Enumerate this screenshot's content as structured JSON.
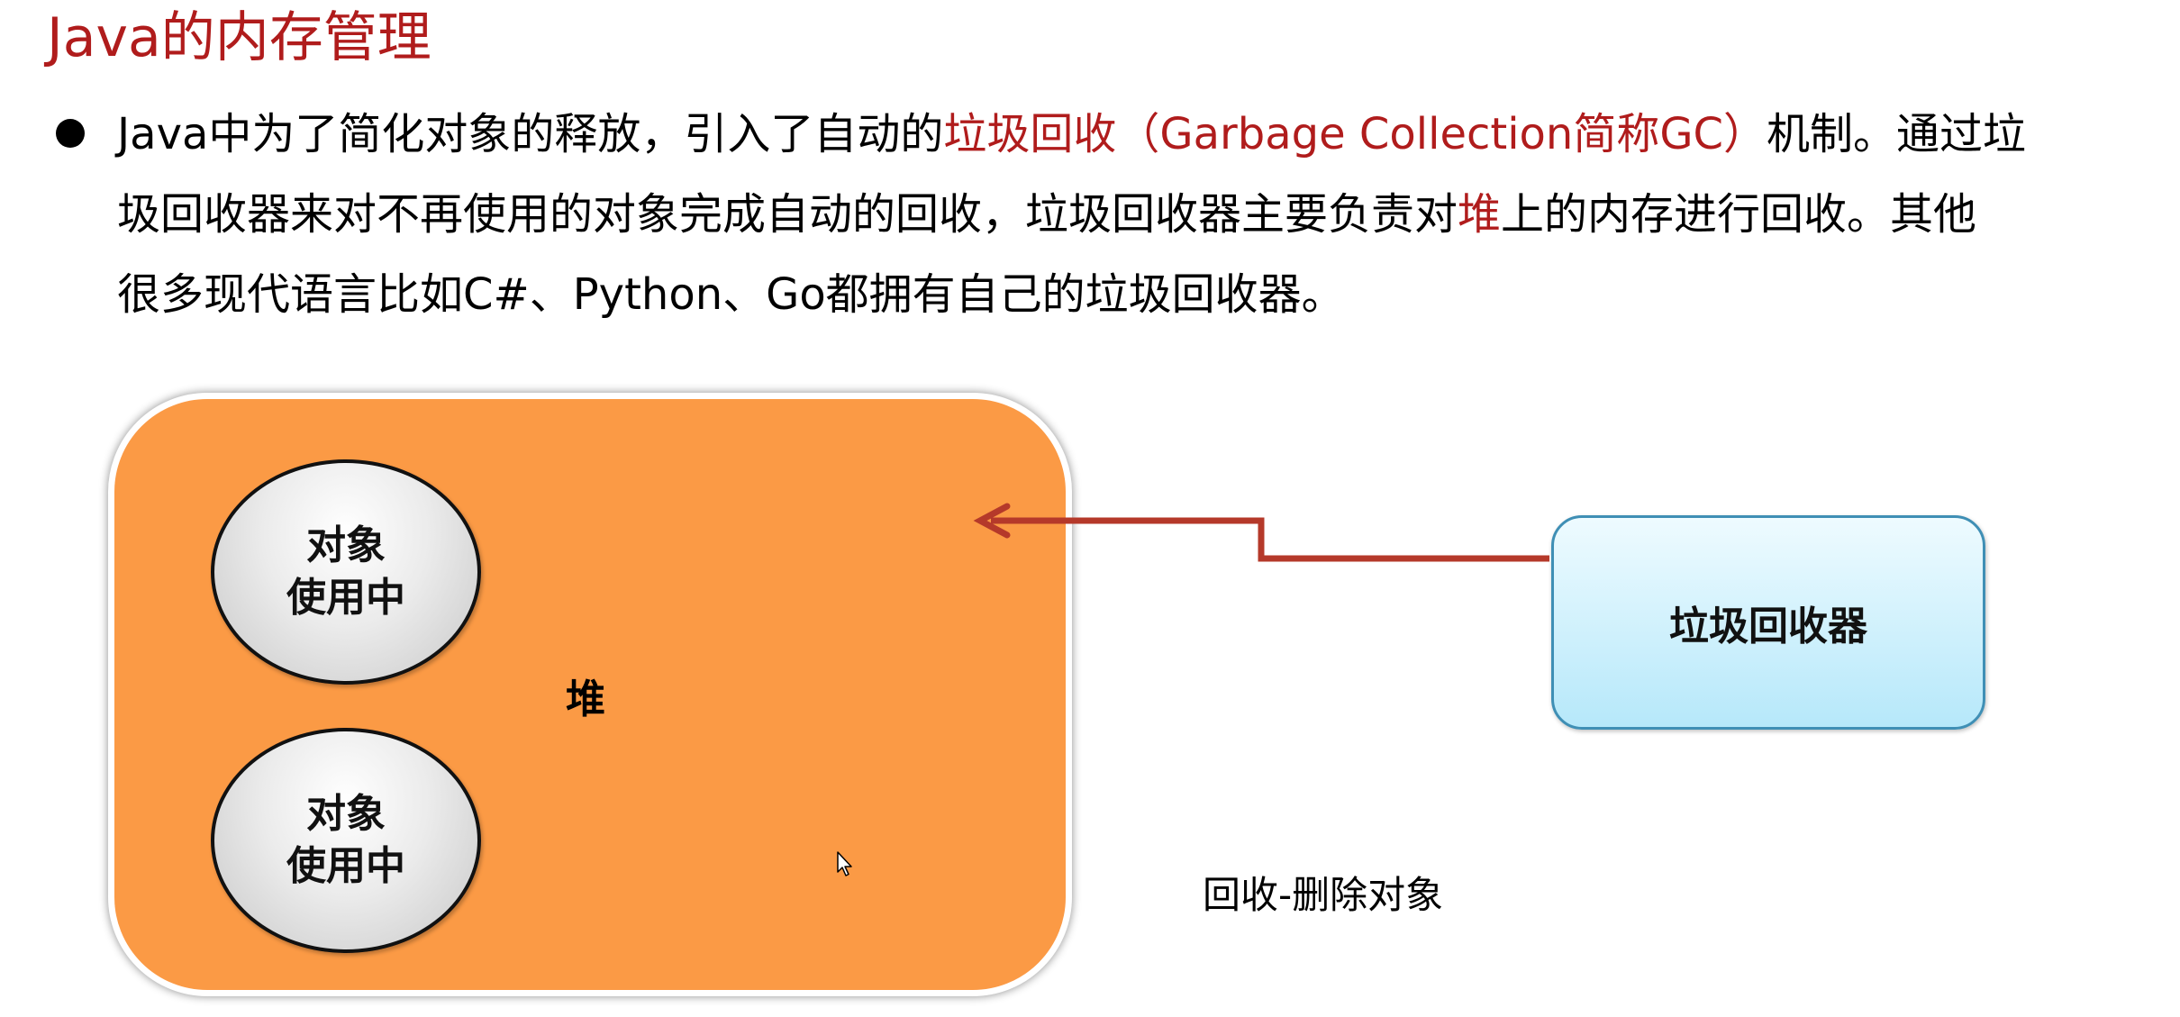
{
  "slide": {
    "title": "Java的内存管理"
  },
  "bullet": {
    "line1_a": "Java中为了简化对象的释放，引入了自动的",
    "line1_hl": "垃圾回收（Garbage Collection简称GC）",
    "line1_b": "机制。通过垃",
    "line2_a": "圾回收器来对不再使用的对象完成自动的回收，垃圾回收器主要负责对",
    "line2_hl": "堆",
    "line2_b": "上的内存进行回收。其他",
    "line3": "很多现代语言比如C#、Python、Go都拥有自己的垃圾回收器。"
  },
  "diagram": {
    "heap_label": "堆",
    "objects": [
      {
        "label_line1": "对象",
        "label_line2": "使用中"
      },
      {
        "label_line1": "对象",
        "label_line2": "使用中"
      }
    ],
    "gc_label": "垃圾回收器",
    "caption": "回收-删除对象"
  },
  "colors": {
    "title": "#b01c1c",
    "highlight": "#b01c1c",
    "heap_fill": "#fb9a45",
    "arrow": "#b5392a",
    "gc_border": "#3f8fb5",
    "gc_fill_top": "#eefbff",
    "gc_fill_bottom": "#b6e8fa"
  },
  "icons": {
    "cursor": "mouse-pointer-icon",
    "bullet": "bullet-dot-icon"
  }
}
